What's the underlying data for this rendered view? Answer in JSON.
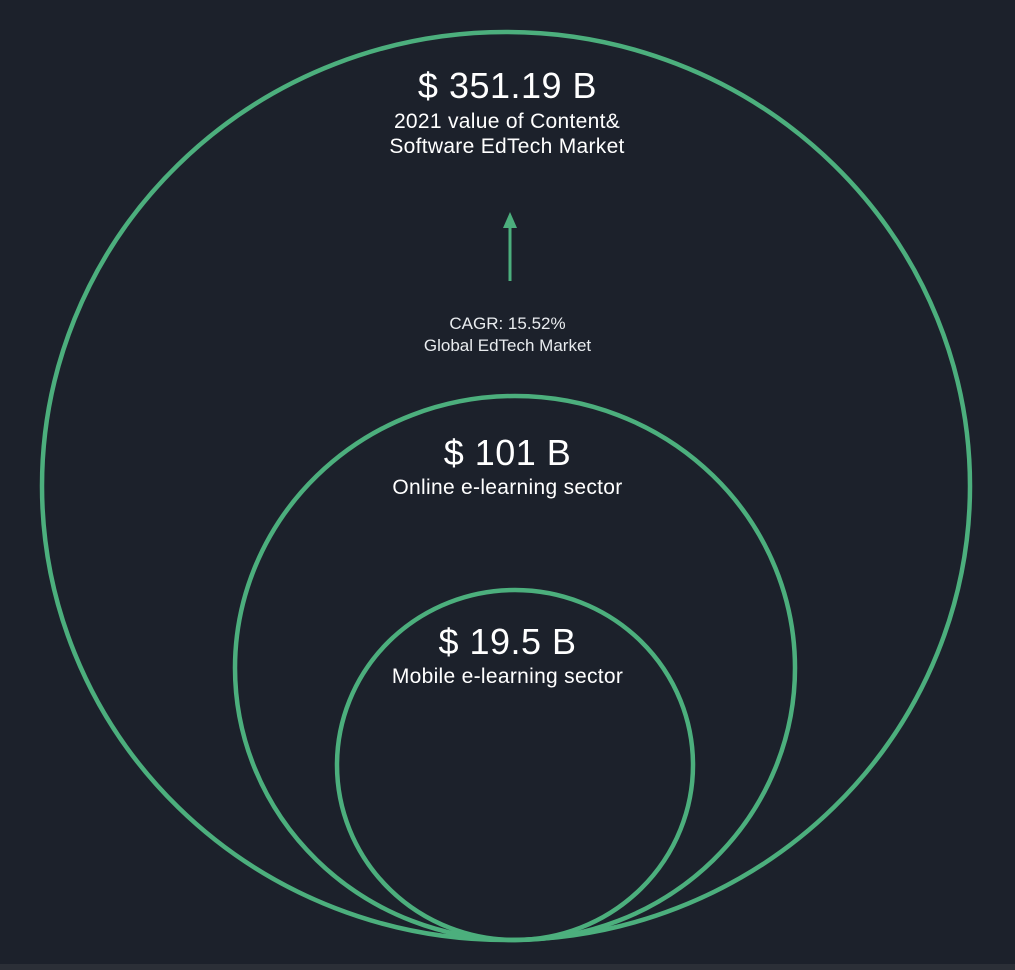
{
  "colors": {
    "background": "#1c212b",
    "circle_stroke": "#4caf7d",
    "text": "#ffffff"
  },
  "outer": {
    "value": "$ 351.19 B",
    "description": "2021 value of Content& Software EdTech Market"
  },
  "growth": {
    "arrow_icon": "up-arrow-icon",
    "cagr": "CAGR: 15.52%",
    "market": "Global EdTech Market"
  },
  "middle": {
    "value": "$ 101 B",
    "description": "Online e-learning sector"
  },
  "inner": {
    "value": "$ 19.5 B",
    "description": "Mobile e-learning sector"
  }
}
